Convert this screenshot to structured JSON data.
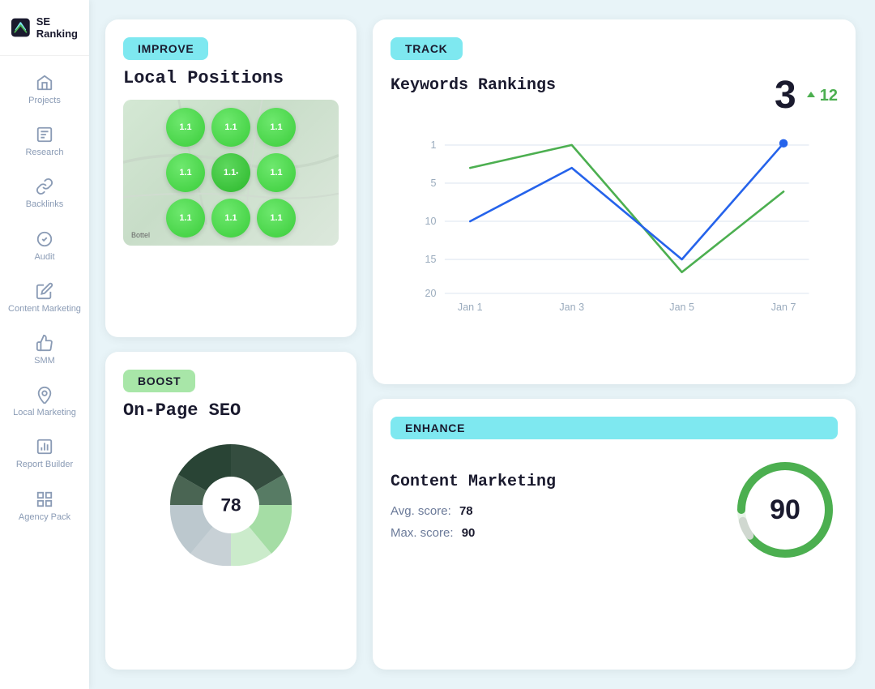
{
  "app": {
    "name": "SE Ranking"
  },
  "sidebar": {
    "items": [
      {
        "id": "projects",
        "label": "Projects",
        "icon": "home"
      },
      {
        "id": "research",
        "label": "Research",
        "icon": "research"
      },
      {
        "id": "backlinks",
        "label": "Backlinks",
        "icon": "link"
      },
      {
        "id": "audit",
        "label": "Audit",
        "icon": "check-circle"
      },
      {
        "id": "content-marketing",
        "label": "Content Marketing",
        "icon": "edit"
      },
      {
        "id": "smm",
        "label": "SMM",
        "icon": "thumb-up"
      },
      {
        "id": "local-marketing",
        "label": "Local Marketing",
        "icon": "location"
      },
      {
        "id": "report-builder",
        "label": "Report Builder",
        "icon": "report"
      },
      {
        "id": "agency-pack",
        "label": "Agency Pack",
        "icon": "grid"
      }
    ]
  },
  "improve_card": {
    "badge": "IMPROVE",
    "title": "Local Positions",
    "grid_values": [
      "1.1",
      "1.1",
      "1.1",
      "1.1",
      "1.1",
      "1.1",
      "1.1",
      "1.1",
      "1.1"
    ],
    "map_label": "Bottel"
  },
  "boost_card": {
    "badge": "BOOST",
    "title": "On-Page SEO",
    "score": "78"
  },
  "track_card": {
    "badge": "TRACK",
    "title": "Keywords Rankings",
    "big_number": "3",
    "change": "12",
    "x_labels": [
      "Jan 1",
      "Jan 3",
      "Jan 5",
      "Jan 7"
    ],
    "y_labels": [
      "1",
      "5",
      "10",
      "15",
      "20"
    ]
  },
  "enhance_card": {
    "badge": "ENHANCE",
    "title": "Content Marketing",
    "avg_label": "Avg. score:",
    "avg_value": "78",
    "max_label": "Max. score:",
    "max_value": "90",
    "circle_value": "90",
    "circle_percent": 90
  }
}
